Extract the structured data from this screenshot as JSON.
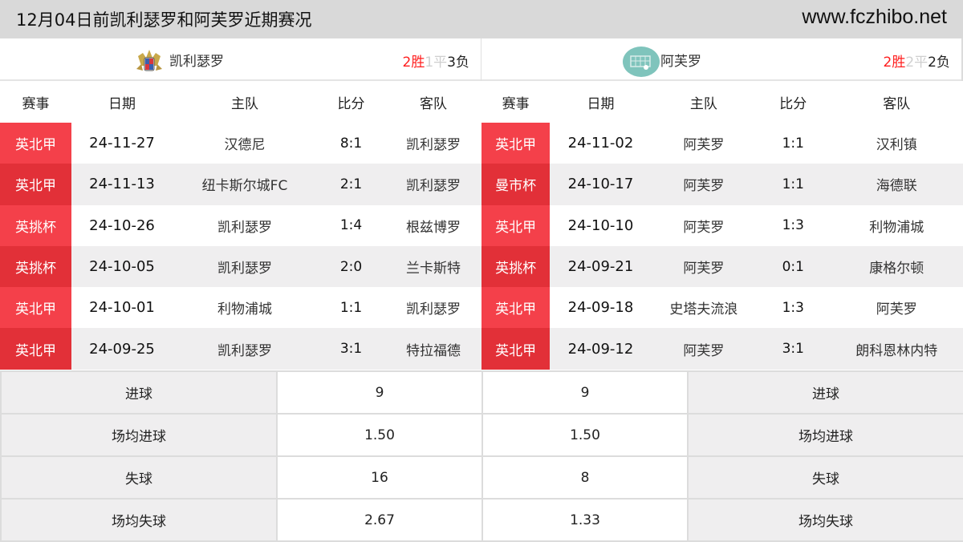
{
  "header": {
    "title": "12月04日前凯利瑟罗和阿芙罗近期赛况",
    "site": "www.fczhibo.net"
  },
  "columns": [
    "赛事",
    "日期",
    "主队",
    "比分",
    "客队"
  ],
  "left": {
    "team": "凯利瑟罗",
    "logo_icon": "club-crest-icon",
    "record": {
      "win": "2",
      "win_label": "胜",
      "draw": "1",
      "draw_label": "平",
      "loss": "3",
      "loss_label": "负"
    },
    "matches": [
      {
        "comp": "英北甲",
        "date": "24-11-27",
        "home": "汉德尼",
        "score": "8:1",
        "away": "凯利瑟罗"
      },
      {
        "comp": "英北甲",
        "date": "24-11-13",
        "home": "纽卡斯尔城FC",
        "score": "2:1",
        "away": "凯利瑟罗"
      },
      {
        "comp": "英挑杯",
        "date": "24-10-26",
        "home": "凯利瑟罗",
        "score": "1:4",
        "away": "根兹博罗"
      },
      {
        "comp": "英挑杯",
        "date": "24-10-05",
        "home": "凯利瑟罗",
        "score": "2:0",
        "away": "兰卡斯特"
      },
      {
        "comp": "英北甲",
        "date": "24-10-01",
        "home": "利物浦城",
        "score": "1:1",
        "away": "凯利瑟罗"
      },
      {
        "comp": "英北甲",
        "date": "24-09-25",
        "home": "凯利瑟罗",
        "score": "3:1",
        "away": "特拉福德"
      }
    ]
  },
  "right": {
    "team": "阿芙罗",
    "logo_icon": "goal-net-placeholder-icon",
    "record": {
      "win": "2",
      "win_label": "胜",
      "draw": "2",
      "draw_label": "平",
      "loss": "2",
      "loss_label": "负"
    },
    "matches": [
      {
        "comp": "英北甲",
        "date": "24-11-02",
        "home": "阿芙罗",
        "score": "1:1",
        "away": "汉利镇"
      },
      {
        "comp": "曼市杯",
        "date": "24-10-17",
        "home": "阿芙罗",
        "score": "1:1",
        "away": "海德联"
      },
      {
        "comp": "英北甲",
        "date": "24-10-10",
        "home": "阿芙罗",
        "score": "1:3",
        "away": "利物浦城"
      },
      {
        "comp": "英挑杯",
        "date": "24-09-21",
        "home": "阿芙罗",
        "score": "0:1",
        "away": "康格尔顿"
      },
      {
        "comp": "英北甲",
        "date": "24-09-18",
        "home": "史塔夫流浪",
        "score": "1:3",
        "away": "阿芙罗"
      },
      {
        "comp": "英北甲",
        "date": "24-09-12",
        "home": "阿芙罗",
        "score": "3:1",
        "away": "朗科恩林内特"
      }
    ]
  },
  "stats": [
    {
      "label": "进球",
      "left": "9",
      "right": "9"
    },
    {
      "label": "场均进球",
      "left": "1.50",
      "right": "1.50"
    },
    {
      "label": "失球",
      "left": "16",
      "right": "8"
    },
    {
      "label": "场均失球",
      "left": "2.67",
      "right": "1.33"
    }
  ],
  "colors": {
    "win": "#ff1e1e",
    "draw": "#cfcfcf",
    "comp_badge": "#f4404a",
    "comp_badge_alt": "#e23038",
    "header_bg": "#d9d9d9"
  }
}
